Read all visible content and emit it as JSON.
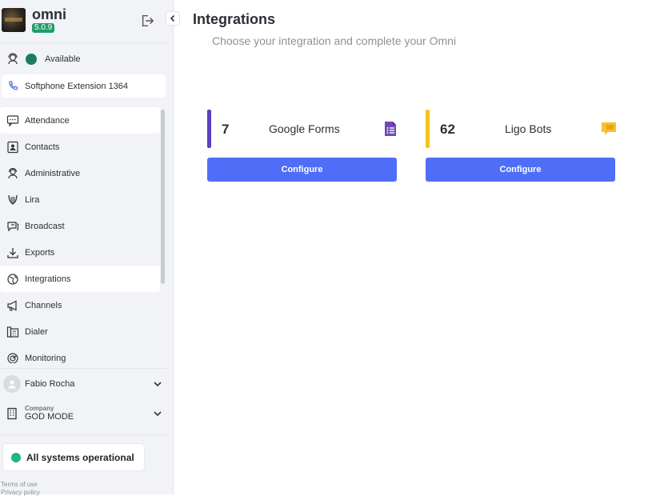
{
  "app": {
    "name": "omni",
    "version": "5.0.9"
  },
  "status": {
    "label": "Available",
    "color": "#1a7f5a"
  },
  "softphone": {
    "label": "Softphone Extension 1364"
  },
  "nav": [
    {
      "label": "Attendance",
      "icon": "chat-icon"
    },
    {
      "label": "Contacts",
      "icon": "contact-card-icon"
    },
    {
      "label": "Administrative",
      "icon": "support-agent-icon"
    },
    {
      "label": "Lira",
      "icon": "lyre-icon"
    },
    {
      "label": "Broadcast",
      "icon": "broadcast-chat-icon"
    },
    {
      "label": "Exports",
      "icon": "download-icon"
    },
    {
      "label": "Integrations",
      "icon": "globe-icon",
      "active": true
    },
    {
      "label": "Channels",
      "icon": "megaphone-icon"
    },
    {
      "label": "Dialer",
      "icon": "fax-icon"
    },
    {
      "label": "Monitoring",
      "icon": "radar-icon"
    }
  ],
  "user": {
    "name": "Fabio Rocha"
  },
  "company": {
    "caption": "Company",
    "name": "GOD MODE"
  },
  "system_status": {
    "label": "All systems operational",
    "color": "#20b486"
  },
  "footer": {
    "terms": "Terms of use",
    "privacy": "Privacy policy"
  },
  "page": {
    "title": "Integrations",
    "subtitle": "Choose your integration and complete your Omni"
  },
  "integrations": [
    {
      "count": "7",
      "name": "Google Forms",
      "accent": "#5b3fc4",
      "icon": "google-forms-icon",
      "button": "Configure"
    },
    {
      "count": "62",
      "name": "Ligo Bots",
      "accent": "#f5c518",
      "icon": "chat-bubble-icon",
      "button": "Configure"
    }
  ]
}
